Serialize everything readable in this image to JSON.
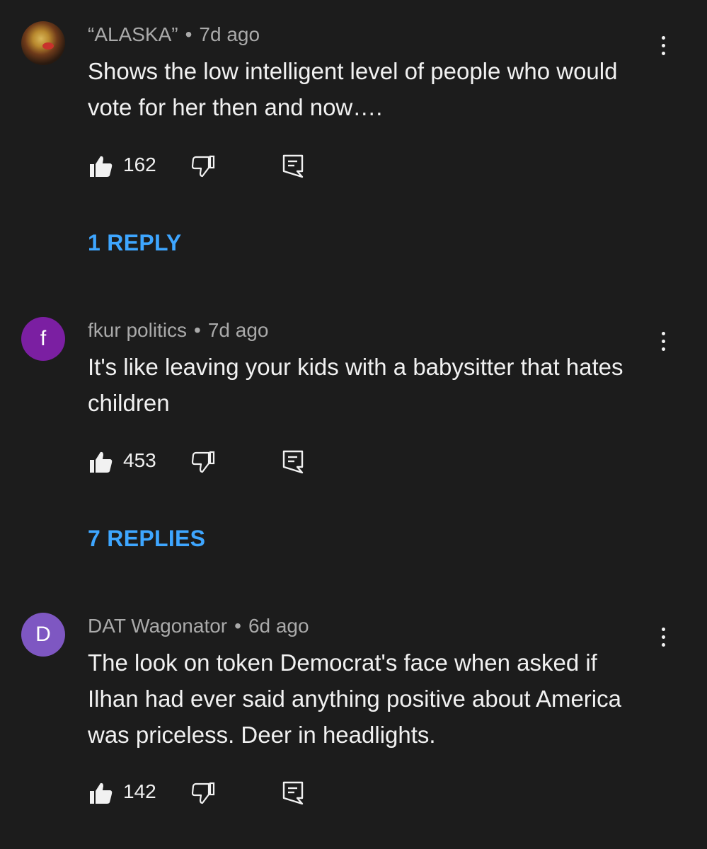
{
  "comments": [
    {
      "author": "“ALASKA”",
      "separator": "•",
      "time": "7d ago",
      "avatar_icon": "profile-photo",
      "avatar_letter": "",
      "avatar_color": "",
      "text": "Shows the low intelligent level of people who would vote for her then and now….",
      "likes": "162",
      "replies_label": "1 REPLY"
    },
    {
      "author": "fkur politics",
      "separator": "•",
      "time": "7d ago",
      "avatar_icon": "letter-avatar",
      "avatar_letter": "f",
      "avatar_color": "#7b1fa2",
      "text": "It's like leaving your kids with a babysitter that hates children",
      "likes": "453",
      "replies_label": "7 REPLIES"
    },
    {
      "author": "DAT Wagonator",
      "separator": "•",
      "time": "6d ago",
      "avatar_icon": "letter-avatar",
      "avatar_letter": "D",
      "avatar_color": "#7e57c2",
      "text": "The look on token Democrat's face when asked if Ilhan had ever said anything positive about America was priceless.  Deer in headlights.",
      "likes": "142",
      "replies_label": ""
    }
  ],
  "colors": {
    "background": "#1c1c1c",
    "primary_text": "#f1f1f1",
    "secondary_text": "#aaaaaa",
    "link": "#3ea6ff"
  },
  "icons": {
    "like": "thumbs-up-icon",
    "dislike": "thumbs-down-icon",
    "reply": "reply-comment-icon",
    "menu": "more-vertical-icon"
  }
}
